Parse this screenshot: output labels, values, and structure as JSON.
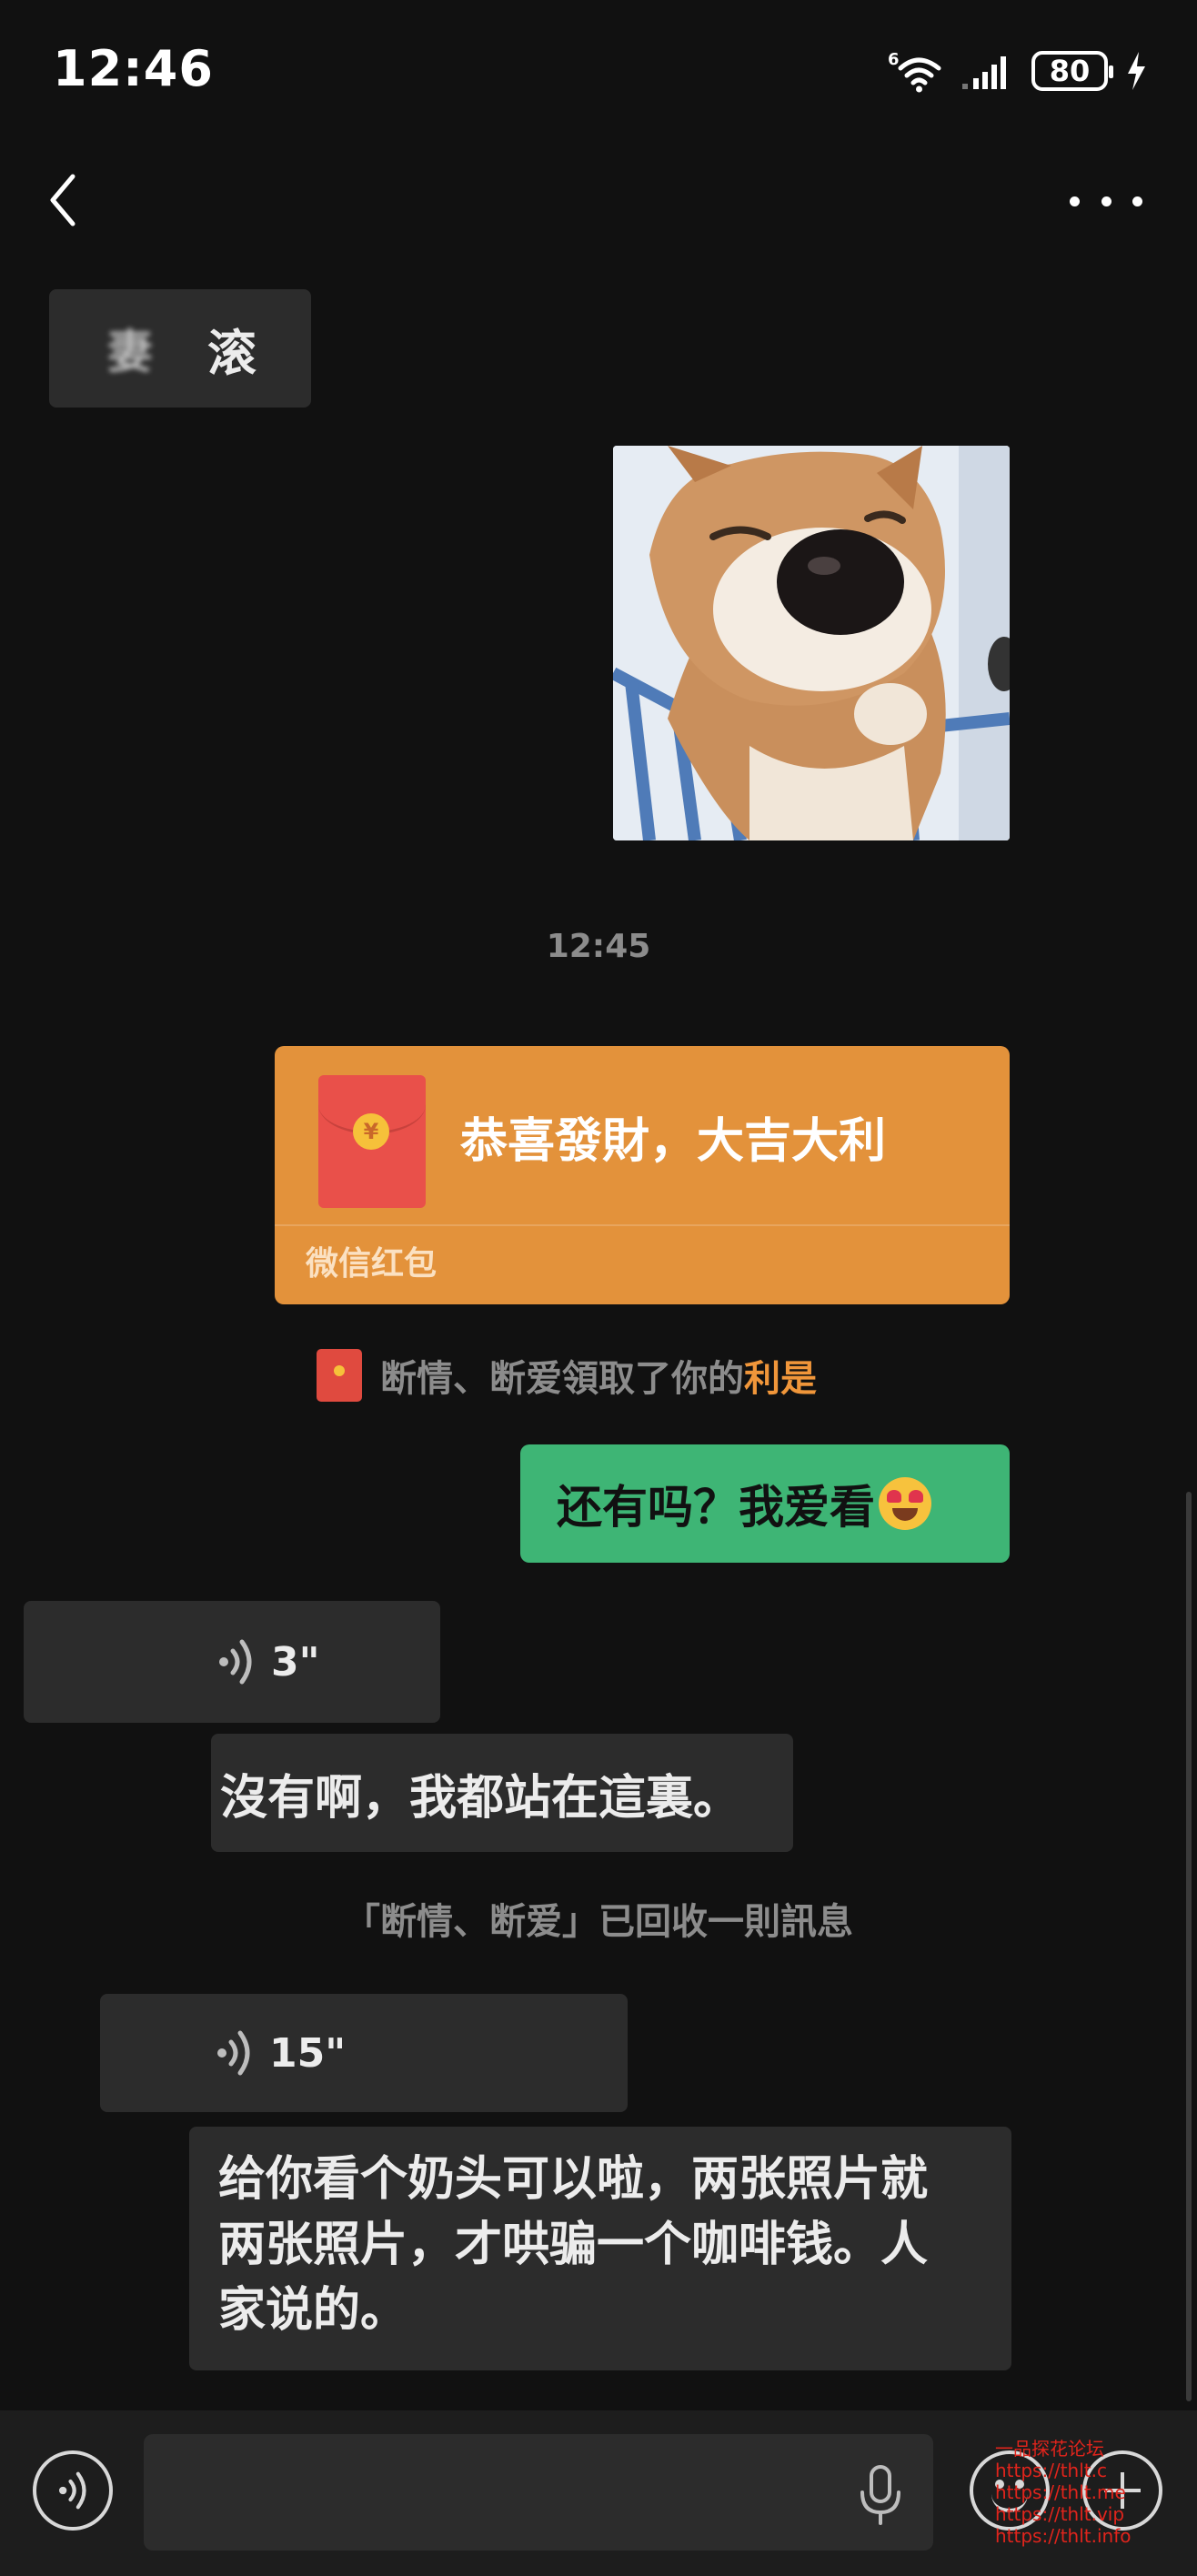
{
  "status_bar": {
    "time": "12:46",
    "signal_label": "6",
    "battery": "80"
  },
  "messages": {
    "incoming_1": {
      "blurred_text": "妻",
      "text": "滚"
    },
    "timestamp": "12:45",
    "red_packet": {
      "title": "恭喜發財，大吉大利",
      "label": "微信红包",
      "coin": "¥"
    },
    "system_notice_1": {
      "text": "断情、断爱領取了你的",
      "link": "利是"
    },
    "outgoing_1": {
      "text": "还有吗？我爱看"
    },
    "voice_1": {
      "duration": "3\""
    },
    "incoming_2": {
      "text": "沒有啊，我都站在這裏。"
    },
    "system_notice_2": {
      "text": "「断情、断爱」已回收一則訊息"
    },
    "voice_2": {
      "duration": "15\""
    },
    "incoming_3": {
      "lines": [
        "给你看个奶头可以啦，两张照片就",
        "两张照片，才哄骗一个咖啡钱。人",
        "家说的。"
      ]
    }
  },
  "input_bar": {
    "placeholder": ""
  },
  "watermark": {
    "lines": [
      "一品探花论坛",
      "https://thlt.c",
      "https://thlt.me",
      "https://thlt.vip",
      "https://thlt.info"
    ]
  },
  "colors": {
    "background": "#111111",
    "bubble_in": "#2c2c2c",
    "bubble_out": "#3eb575",
    "red_packet": "#e3923b",
    "link_accent": "#f0963a"
  },
  "icons": [
    "back-icon",
    "more-icon",
    "wifi-icon",
    "signal-icon",
    "battery-icon",
    "charging-icon",
    "voice-icon",
    "mic-icon",
    "emoji-icon",
    "plus-icon"
  ]
}
